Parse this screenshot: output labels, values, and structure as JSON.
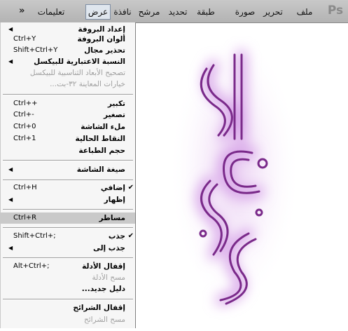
{
  "app": {
    "logo_text": "Ps"
  },
  "menubar": {
    "chevron": "»",
    "items": [
      {
        "label": "ملف"
      },
      {
        "label": "تحرير"
      },
      {
        "label": "صورة"
      },
      {
        "label": "طبقة"
      },
      {
        "label": "تحديد"
      },
      {
        "label": "مرشح"
      },
      {
        "label": "عرض",
        "active": true
      },
      {
        "label": "نافذة"
      },
      {
        "label": "تعليمات"
      }
    ]
  },
  "menu": {
    "items": [
      {
        "label": "إعداد البروفة",
        "shortcut": "",
        "submenu": true
      },
      {
        "label": "ألوان البروفة",
        "shortcut": "Ctrl+Y"
      },
      {
        "label": "تحذير مجال",
        "shortcut": "Shift+Ctrl+Y"
      },
      {
        "label": "النسبة الاعتبارية للبيكسل",
        "shortcut": "",
        "submenu": true
      },
      {
        "label": "تصحيح الأبعاد الثناسبية للبيكسل",
        "shortcut": "",
        "disabled": true
      },
      {
        "label": "خيارات المعاينة ٣٢-بت...",
        "shortcut": "",
        "disabled": true
      },
      {
        "label": "تكبير",
        "shortcut": "Ctrl++"
      },
      {
        "label": "تصغير",
        "shortcut": "Ctrl+-"
      },
      {
        "label": "ملء الشاشة",
        "shortcut": "Ctrl+0"
      },
      {
        "label": "النقاط الحالية",
        "shortcut": "Ctrl+1"
      },
      {
        "label": "حجم الطباعة",
        "shortcut": ""
      },
      {
        "label": "صيغة الشاشة",
        "shortcut": "",
        "submenu": true
      },
      {
        "label": "إضافي",
        "shortcut": "Ctrl+H",
        "checked": true
      },
      {
        "label": "إظهار",
        "shortcut": "",
        "submenu": true
      },
      {
        "label": "مساطر",
        "shortcut": "Ctrl+R",
        "highlighted": true
      },
      {
        "label": "جذب",
        "shortcut": "Shift+Ctrl+;",
        "checked": true
      },
      {
        "label": "جذب إلى",
        "shortcut": "",
        "submenu": true
      },
      {
        "label": "إقفال الأدلة",
        "shortcut": "Alt+Ctrl+;"
      },
      {
        "label": "مسح الأدلة",
        "shortcut": "",
        "disabled": true
      },
      {
        "label": "دليل جديد...",
        "shortcut": ""
      },
      {
        "label": "إقفال الشرائح",
        "shortcut": ""
      },
      {
        "label": "مسح الشرائح",
        "shortcut": "",
        "disabled": true
      }
    ]
  },
  "canvas": {
    "artwork_text": "الحياة عملية"
  },
  "colors": {
    "glow": "#d8a8e8",
    "stroke": "#7a2a8a"
  }
}
